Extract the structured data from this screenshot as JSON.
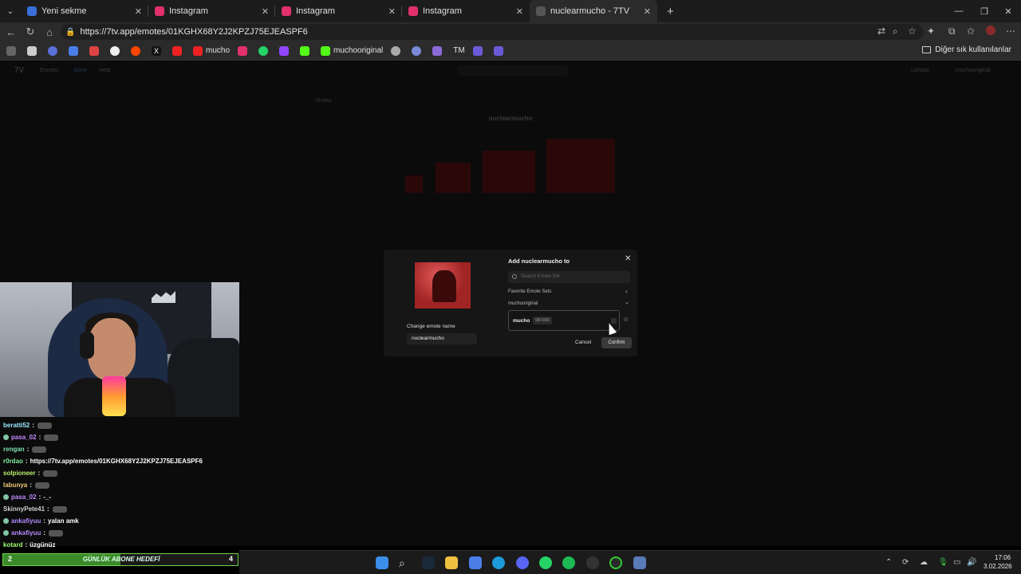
{
  "browser": {
    "tabs": [
      {
        "label": "Yeni sekme",
        "color": "#3a6fd8"
      },
      {
        "label": "Instagram",
        "color": "#e1306c"
      },
      {
        "label": "Instagram",
        "color": "#e1306c"
      },
      {
        "label": "Instagram",
        "color": "#e1306c"
      },
      {
        "label": "nuclearmucho - 7TV",
        "color": "#2b2b2b"
      }
    ],
    "url": "https://7tv.app/emotes/01KGHX68Y2J2KPZJ75EJEASPF6",
    "bookmarks": {
      "mucho": "mucho",
      "muchooriginal": "muchooriginal",
      "tm": "TM",
      "other": "Diğer sık kullanılanlar"
    }
  },
  "site": {
    "nav": {
      "emotes": "Emotes",
      "store": "Store",
      "help": "Help",
      "upload": "Upload",
      "user": "muchooriginal"
    },
    "owner": "r0rdao",
    "title": "nuclearmucho"
  },
  "modal": {
    "title": "Add nuclearmucho to",
    "search_placeholder": "Search Emote Set",
    "favorite_sets": "Favorite Emote Sets",
    "owner_sets": "muchooriginal",
    "set_name": "mucho",
    "set_count": "98/1000",
    "change_label": "Change emote name",
    "emote_name": "nuclearmucho",
    "cancel": "Cancel",
    "confirm": "Confirm"
  },
  "chat": [
    {
      "user": "beratti52",
      "color": "#9ee8ff",
      "msg": "",
      "badge": false,
      "emote": true
    },
    {
      "user": "pasa_02",
      "color": "#c38bff",
      "msg": "",
      "badge": true,
      "emote": true
    },
    {
      "user": "rengan",
      "color": "#7fe3b0",
      "msg": "",
      "badge": false,
      "emote": true
    },
    {
      "user": "r0rdao",
      "color": "#7ff0a0",
      "msg": "https://7tv.app/emotes/01KGHX68Y2J2KPZJ75EJEASPF6",
      "badge": false,
      "emote": false
    },
    {
      "user": "solpioneer",
      "color": "#b8f06a",
      "msg": "",
      "badge": false,
      "emote": true
    },
    {
      "user": "labunya",
      "color": "#f0c87a",
      "msg": "",
      "badge": false,
      "emote": true
    },
    {
      "user": "pasa_02",
      "color": "#c38bff",
      "msg": "-_-",
      "badge": true,
      "emote": false
    },
    {
      "user": "SkinnyPete41",
      "color": "#d0d0d0",
      "msg": "",
      "badge": false,
      "emote": true
    },
    {
      "user": "ankafiyuu",
      "color": "#b689ff",
      "msg": "yalan amk",
      "badge": true,
      "emote": false
    },
    {
      "user": "ankafiyuu",
      "color": "#b689ff",
      "msg": "",
      "badge": true,
      "emote": true
    },
    {
      "user": "kotard",
      "color": "#9cff70",
      "msg": "üzgünüz",
      "badge": false,
      "emote": false
    }
  ],
  "goal": {
    "current": "2",
    "label": "GÜNLÜK ABONE HEDEFİ",
    "max": "4",
    "progress": 0.5
  },
  "taskbar": {
    "time": "17:06",
    "date": "3.02.2026"
  }
}
